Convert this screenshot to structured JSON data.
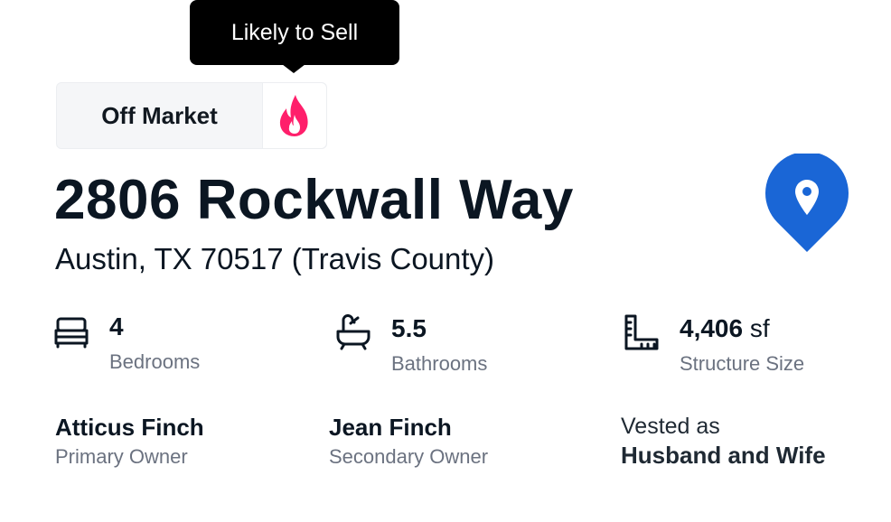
{
  "tooltip": {
    "text": "Likely to Sell"
  },
  "status": {
    "label": "Off Market",
    "indicator_icon": "fire-icon",
    "indicator_color": "#ff1f6b"
  },
  "property": {
    "address": "2806 Rockwall Way",
    "locality": "Austin, TX 70517 (Travis County)",
    "map_icon": "map-pin-icon",
    "map_color": "#1a66d6"
  },
  "stats": {
    "bedrooms": {
      "value": "4",
      "label": "Bedrooms",
      "icon": "bed-icon"
    },
    "bathrooms": {
      "value": "5.5",
      "label": "Bathrooms",
      "icon": "bathtub-icon"
    },
    "structure": {
      "value": "4,406",
      "unit": "sf",
      "label": "Structure Size",
      "icon": "ruler-icon"
    }
  },
  "owners": {
    "primary": {
      "name": "Atticus Finch",
      "role": "Primary Owner"
    },
    "secondary": {
      "name": "Jean Finch",
      "role": "Secondary Owner"
    },
    "vesting": {
      "prefix": "Vested as",
      "value": "Husband and Wife"
    }
  }
}
